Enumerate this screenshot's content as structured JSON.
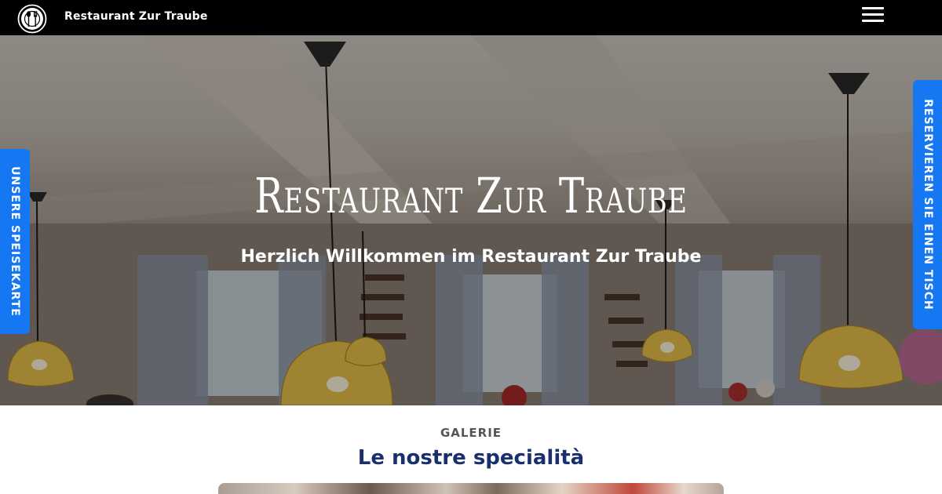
{
  "header": {
    "brand": "Restaurant Zur Traube",
    "logo_icon": "cutlery-icon",
    "menu_icon": "hamburger-menu-icon"
  },
  "hero": {
    "title": "Restaurant Zur Traube",
    "subtitle": "Herzlich Willkommen im Restaurant Zur Traube"
  },
  "side_tabs": {
    "left": "UNSERE SPEISEKARTE",
    "right": "RESERVIEREN SIE EINEN TISCH"
  },
  "gallery": {
    "label": "GALERIE",
    "title": "Le nostre specialità"
  },
  "colors": {
    "topbar": "#000000",
    "accent_blue": "#1677f2",
    "heading_navy": "#1a2f6d",
    "lamp_yellow": "#e8c24a"
  }
}
